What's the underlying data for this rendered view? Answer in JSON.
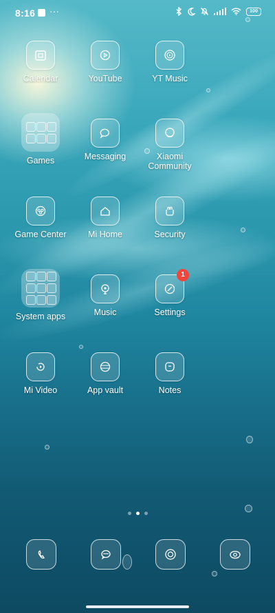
{
  "status_bar": {
    "time": "8:16",
    "more": "···",
    "battery": "100",
    "icons": [
      "bluetooth-icon",
      "dnd-moon-icon",
      "mute-bell-icon",
      "signal-icon",
      "wifi-icon",
      "battery-icon"
    ]
  },
  "apps": [
    {
      "label": "Calendar",
      "icon": "calendar-icon"
    },
    {
      "label": "YouTube",
      "icon": "youtube-icon"
    },
    {
      "label": "YT Music",
      "icon": "yt-music-icon"
    },
    {
      "label": "Games",
      "icon": "folder-icon"
    },
    {
      "label": "Messaging",
      "icon": "messaging-icon"
    },
    {
      "label": "Xiaomi Community",
      "icon": "xiaomi-community-icon"
    },
    {
      "label": "Game Center",
      "icon": "game-center-icon"
    },
    {
      "label": "Mi Home",
      "icon": "mi-home-icon"
    },
    {
      "label": "Security",
      "icon": "security-icon"
    },
    {
      "label": "System apps",
      "icon": "folder-icon"
    },
    {
      "label": "Music",
      "icon": "music-icon"
    },
    {
      "label": "Settings",
      "icon": "settings-icon",
      "badge": "1"
    },
    {
      "label": "Mi Video",
      "icon": "mi-video-icon"
    },
    {
      "label": "App vault",
      "icon": "app-vault-icon"
    },
    {
      "label": "Notes",
      "icon": "notes-icon"
    }
  ],
  "page_indicator": {
    "pages": 3,
    "active": 2
  },
  "dock": [
    {
      "icon": "phone-icon"
    },
    {
      "icon": "messages-icon"
    },
    {
      "icon": "browser-icon"
    },
    {
      "icon": "camera-icon"
    }
  ],
  "colors": {
    "badge": "#f2463c",
    "water_top": "#55b9c8",
    "water_bottom": "#0d4a62"
  }
}
